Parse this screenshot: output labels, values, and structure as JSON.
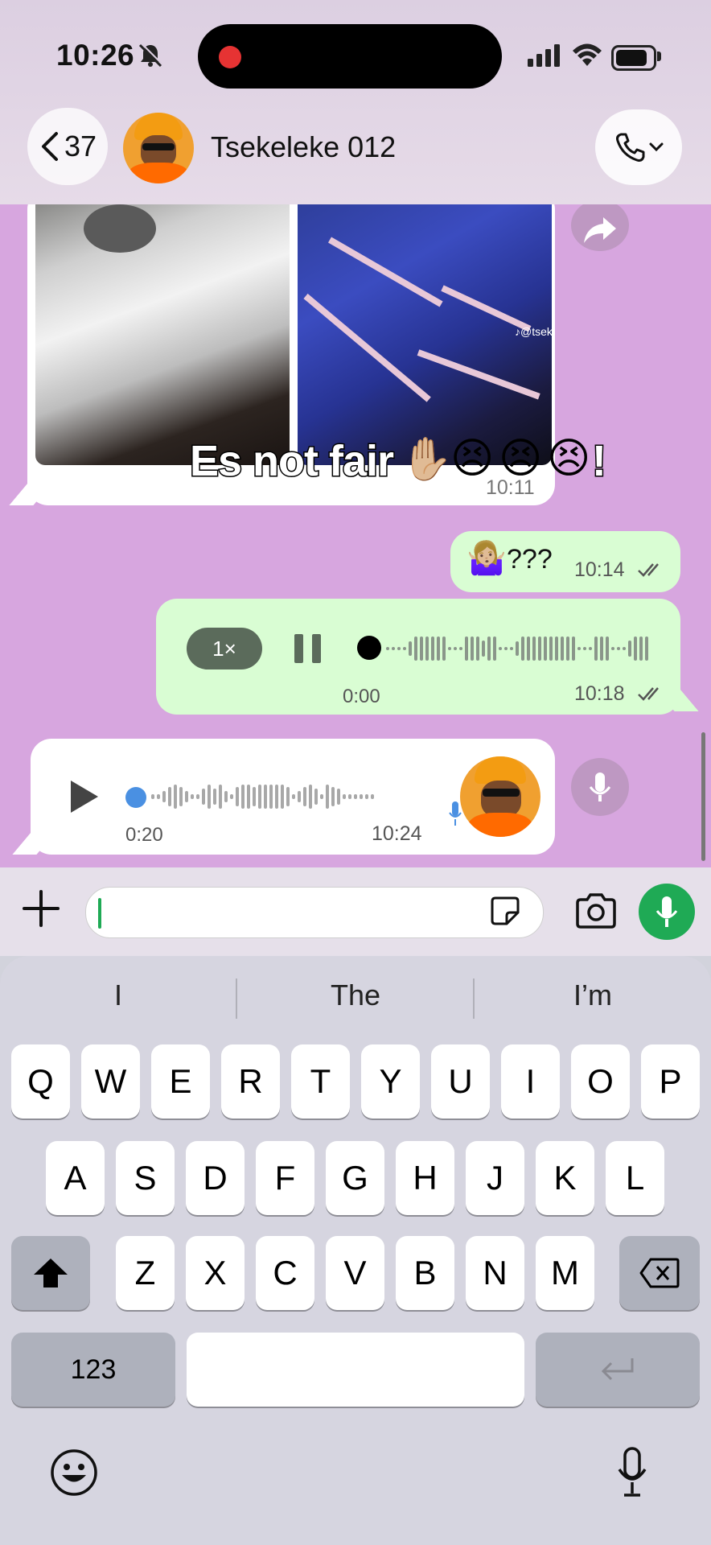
{
  "status_bar": {
    "time": "10:26"
  },
  "header": {
    "back_count": "37",
    "contact_name": "Tsekeleke 012"
  },
  "messages": {
    "media": {
      "caption": "Es not fair",
      "emojis": [
        "✋🏼",
        "😣",
        "😣",
        "😣",
        "!"
      ],
      "watermark": "♪@tsek",
      "time": "10:11"
    },
    "outgoing_text": {
      "text": "???",
      "emoji": "🤷🏼‍♀️",
      "time": "10:14"
    },
    "outgoing_voice": {
      "speed": "1×",
      "elapsed": "0:00",
      "time": "10:18"
    },
    "incoming_voice": {
      "duration": "0:20",
      "time": "10:24"
    }
  },
  "input": {
    "placeholder": ""
  },
  "keyboard": {
    "suggestions": [
      "I",
      "The",
      "I’m"
    ],
    "row1": [
      "Q",
      "W",
      "E",
      "R",
      "T",
      "Y",
      "U",
      "I",
      "O",
      "P"
    ],
    "row2": [
      "A",
      "S",
      "D",
      "F",
      "G",
      "H",
      "J",
      "K",
      "L"
    ],
    "row3": [
      "Z",
      "X",
      "C",
      "V",
      "B",
      "N",
      "M"
    ],
    "numbers_key": "123"
  },
  "colors": {
    "chat_bg": "#d7a6df",
    "outgoing_bubble": "#d9fdd3",
    "accent_green": "#1faa55"
  }
}
